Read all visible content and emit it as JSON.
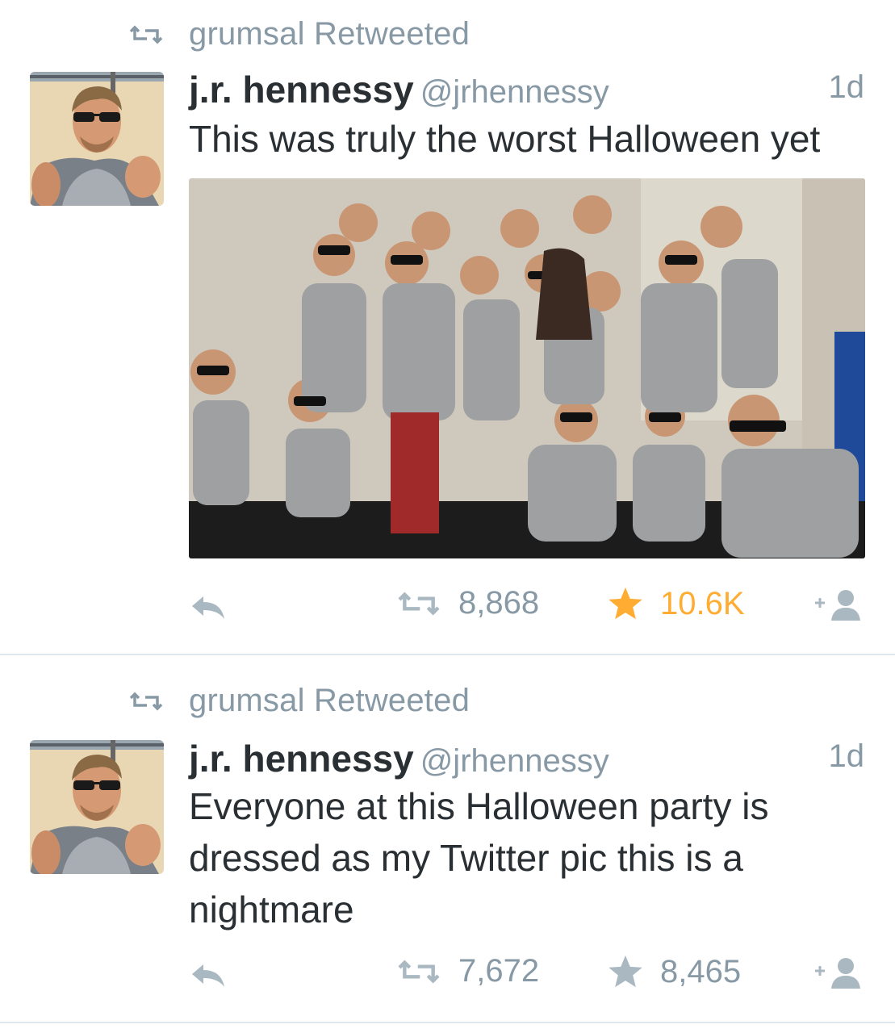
{
  "tweets": [
    {
      "retweet_label": "grumsal Retweeted",
      "author_name": "j.r. hennessy",
      "author_handle": "@jrhennessy",
      "time": "1d",
      "text_lines": [
        "This was truly the worst Halloween yet"
      ],
      "has_media": true,
      "retweets": "8,868",
      "favorites": "10.6K",
      "favorited": true
    },
    {
      "retweet_label": "grumsal Retweeted",
      "author_name": "j.r. hennessy",
      "author_handle": "@jrhennessy",
      "time": "1d",
      "text_lines": [
        "Everyone at this Halloween party is",
        "dressed as my Twitter pic this is a",
        "nightmare"
      ],
      "has_media": false,
      "retweets": "7,672",
      "favorites": "8,465",
      "favorited": false
    }
  ],
  "icons": {
    "retweet": "retweet-icon",
    "reply": "reply-icon",
    "favorite": "star-icon",
    "follow": "follow-icon"
  },
  "colors": {
    "gray": "#8899a6",
    "text": "#292f33",
    "star_active": "#ffac33",
    "divider": "#e1e8ed"
  }
}
